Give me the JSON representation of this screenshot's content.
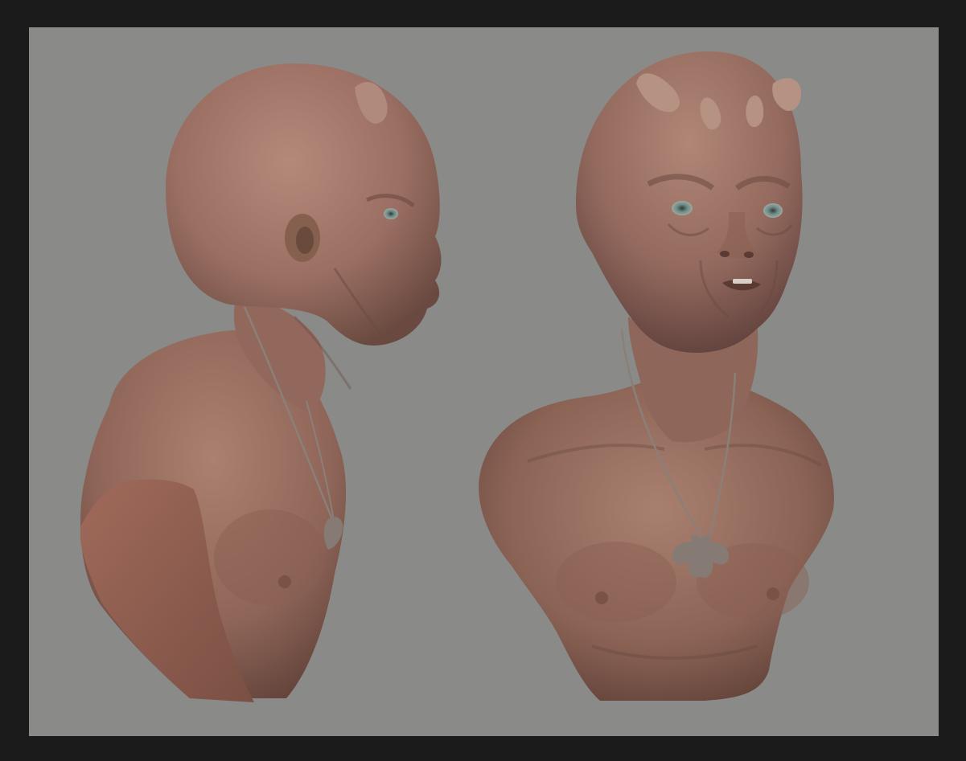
{
  "scene": {
    "background_color": "#8a8a88",
    "border_color": "#1b1b1b",
    "skin_base": "#9a7064",
    "skin_light": "#b48a7c",
    "skin_shadow": "#5e4038",
    "cut_face": "#8c5e50",
    "cord_color": "#8a8078",
    "pendant_color": "#857a74",
    "eye_color": "#6f8a86"
  },
  "views": [
    {
      "id": "side-view",
      "description_icon": "bust-side-view"
    },
    {
      "id": "front-view",
      "description_icon": "bust-front-view"
    }
  ]
}
